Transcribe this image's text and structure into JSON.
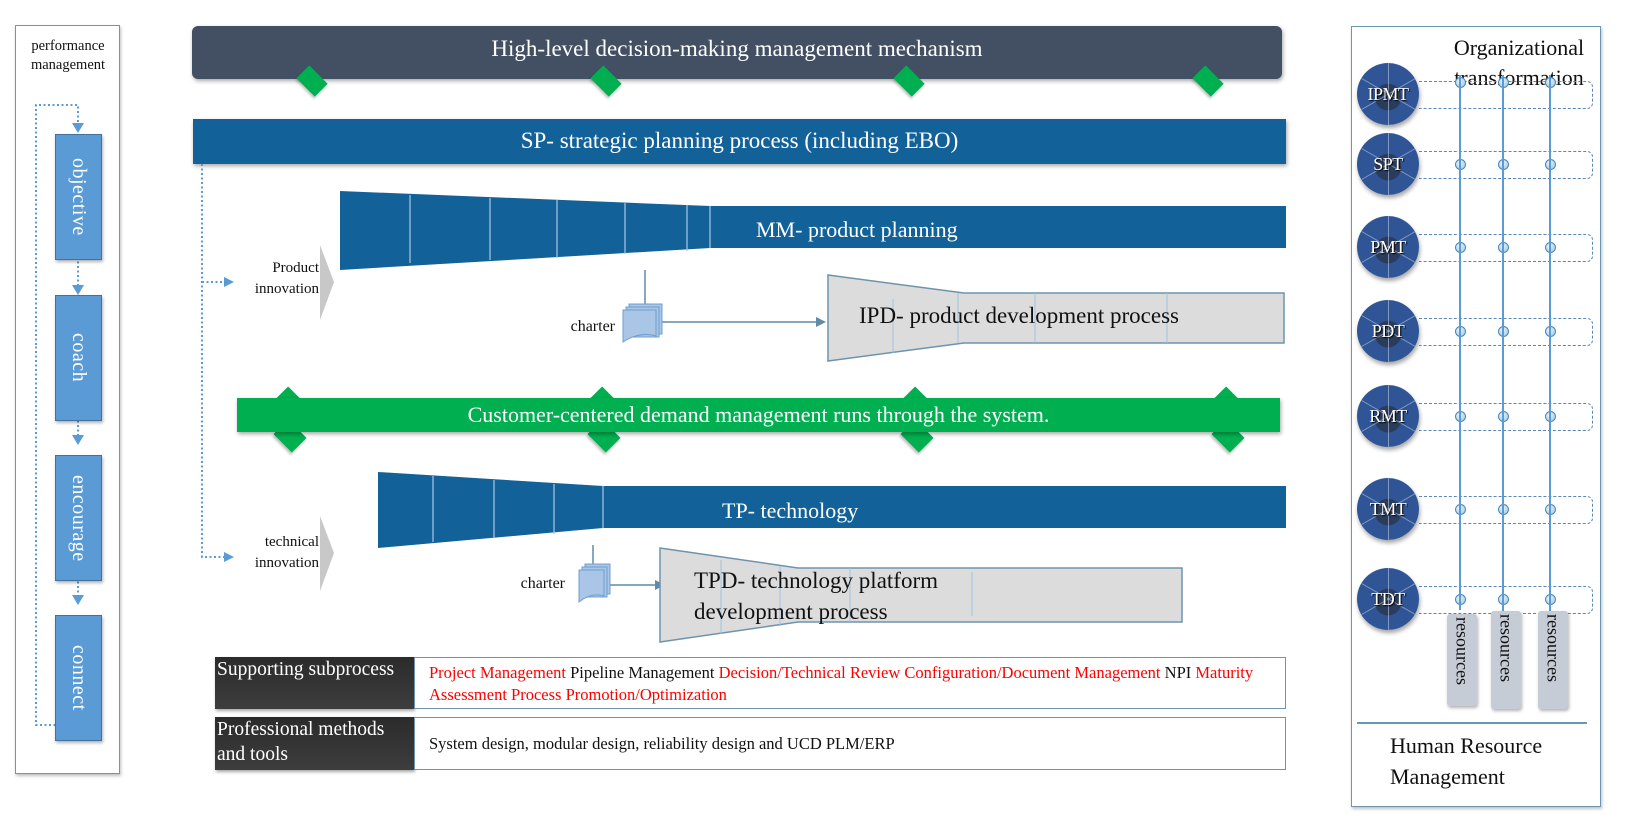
{
  "performance": {
    "title": "performance management",
    "steps": [
      "objective",
      "coach",
      "encourage",
      "connect"
    ]
  },
  "top": {
    "decision_bar": "High-level decision-making management mechanism",
    "sp_bar": "SP- strategic planning process (including EBO)"
  },
  "product": {
    "input_label": "Product innovation",
    "planning": "MM- product planning",
    "charter": "charter",
    "development": "IPD- product development process"
  },
  "demand_bar": "Customer-centered demand management runs through the system.",
  "technology": {
    "input_label": "technical innovation",
    "planning": "TP- technology",
    "charter": "charter",
    "development": "TPD- technology platform development process"
  },
  "table": {
    "rows": [
      {
        "label": "Supporting subprocess",
        "items": [
          {
            "text": "Project Management ",
            "color": "red"
          },
          {
            "text": " Pipeline Management ",
            "color": "black"
          },
          {
            "text": "Decision/Technical Review  Configuration/Document Management ",
            "color": "red"
          },
          {
            "text": "NPI ",
            "color": "black"
          },
          {
            "text": "Maturity Assessment Process Promotion/Optimization",
            "color": "red"
          }
        ]
      },
      {
        "label": "Professional methods and tools",
        "items": [
          {
            "text": "System design, modular design, reliability design  and UCD  PLM/ERP",
            "color": "black"
          }
        ]
      }
    ]
  },
  "organization": {
    "title": "Organizational transformation",
    "teams": [
      "IPMT",
      "SPT",
      "PMT",
      "PDT",
      "RMT",
      "TMT",
      "TDT"
    ],
    "resources": [
      "resources",
      "resources",
      "resources"
    ],
    "footer": "Human Resource Management"
  },
  "colors": {
    "dark_bar": "#434f63",
    "blue_bar": "#126199",
    "green": "#00b050",
    "step_blue": "#5b9bd5",
    "team_blue": "#2f5597",
    "red_text": "#ff0000"
  }
}
